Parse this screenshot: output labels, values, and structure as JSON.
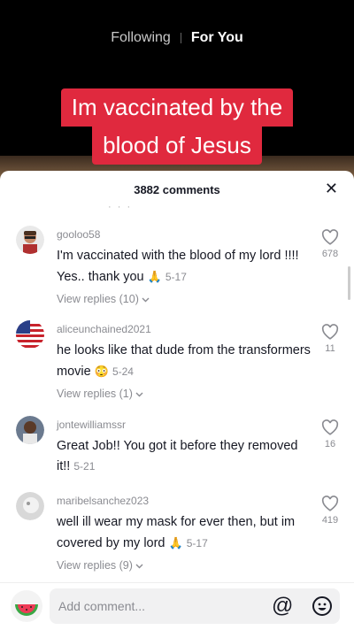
{
  "header": {
    "tab_following": "Following",
    "tab_foryou": "For You"
  },
  "caption": {
    "line1": "Im vaccinated by the",
    "line2": "blood of Jesus"
  },
  "sheet": {
    "title": "3882 comments",
    "close": "✕"
  },
  "comments": [
    {
      "username": "gooloo58",
      "text": "I'm vaccinated with the blood of my lord !!!! Yes.. thank you",
      "emoji": "🙏",
      "date": "5-17",
      "replies": "View replies (10)",
      "likes": "678"
    },
    {
      "username": "aliceunchained2021",
      "text": "he looks like that dude from the transformers movie",
      "emoji": "😳",
      "date": "5-24",
      "replies": "View replies (1)",
      "likes": "11"
    },
    {
      "username": "jontewilliamssr",
      "text": "Great Job!! You got it before they removed it!!",
      "emoji": "",
      "date": "5-21",
      "replies": "",
      "likes": "16"
    },
    {
      "username": "maribelsanchez023",
      "text": "well ill wear my mask for ever then, but im covered by my lord",
      "emoji": "🙏",
      "date": "5-17",
      "replies": "View replies (9)",
      "likes": "419"
    }
  ],
  "input": {
    "placeholder": "Add comment..."
  },
  "colors": {
    "accent": "#e0293e"
  }
}
